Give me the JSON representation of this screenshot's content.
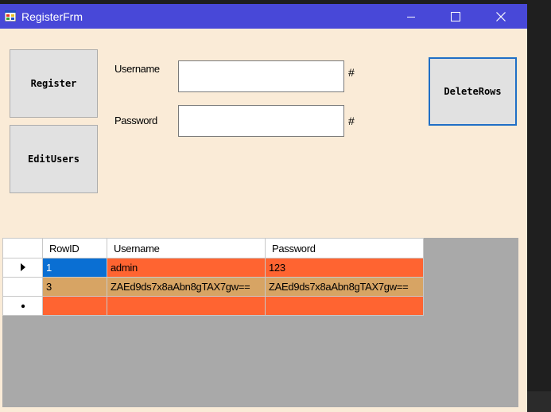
{
  "window": {
    "title": "RegisterFrm"
  },
  "colors": {
    "form_bg": "#faebd7",
    "titlebar": "#4848d8",
    "row_red": "#ff6431",
    "row_tan": "#d7a464",
    "selected": "#0a6fd3"
  },
  "buttons": {
    "register": "Register",
    "edit_users": "EditUsers",
    "delete_rows": "DeleteRows"
  },
  "fields": {
    "username_label": "Username",
    "password_label": "Password",
    "username_value": "",
    "password_value": "",
    "username_suffix": "#",
    "password_suffix": "#"
  },
  "grid": {
    "columns": [
      "RowID",
      "Username",
      "Password"
    ],
    "rows": [
      {
        "indicator": "current-row-arrow",
        "rowid": "1",
        "username": "admin",
        "password": "123"
      },
      {
        "indicator": "",
        "rowid": "3",
        "username": "ZAEd9ds7x8aAbn8gTAX7gw==",
        "password": "ZAEd9ds7x8aAbn8gTAX7gw=="
      }
    ],
    "new_row_indicator": "new-row-asterisk"
  }
}
